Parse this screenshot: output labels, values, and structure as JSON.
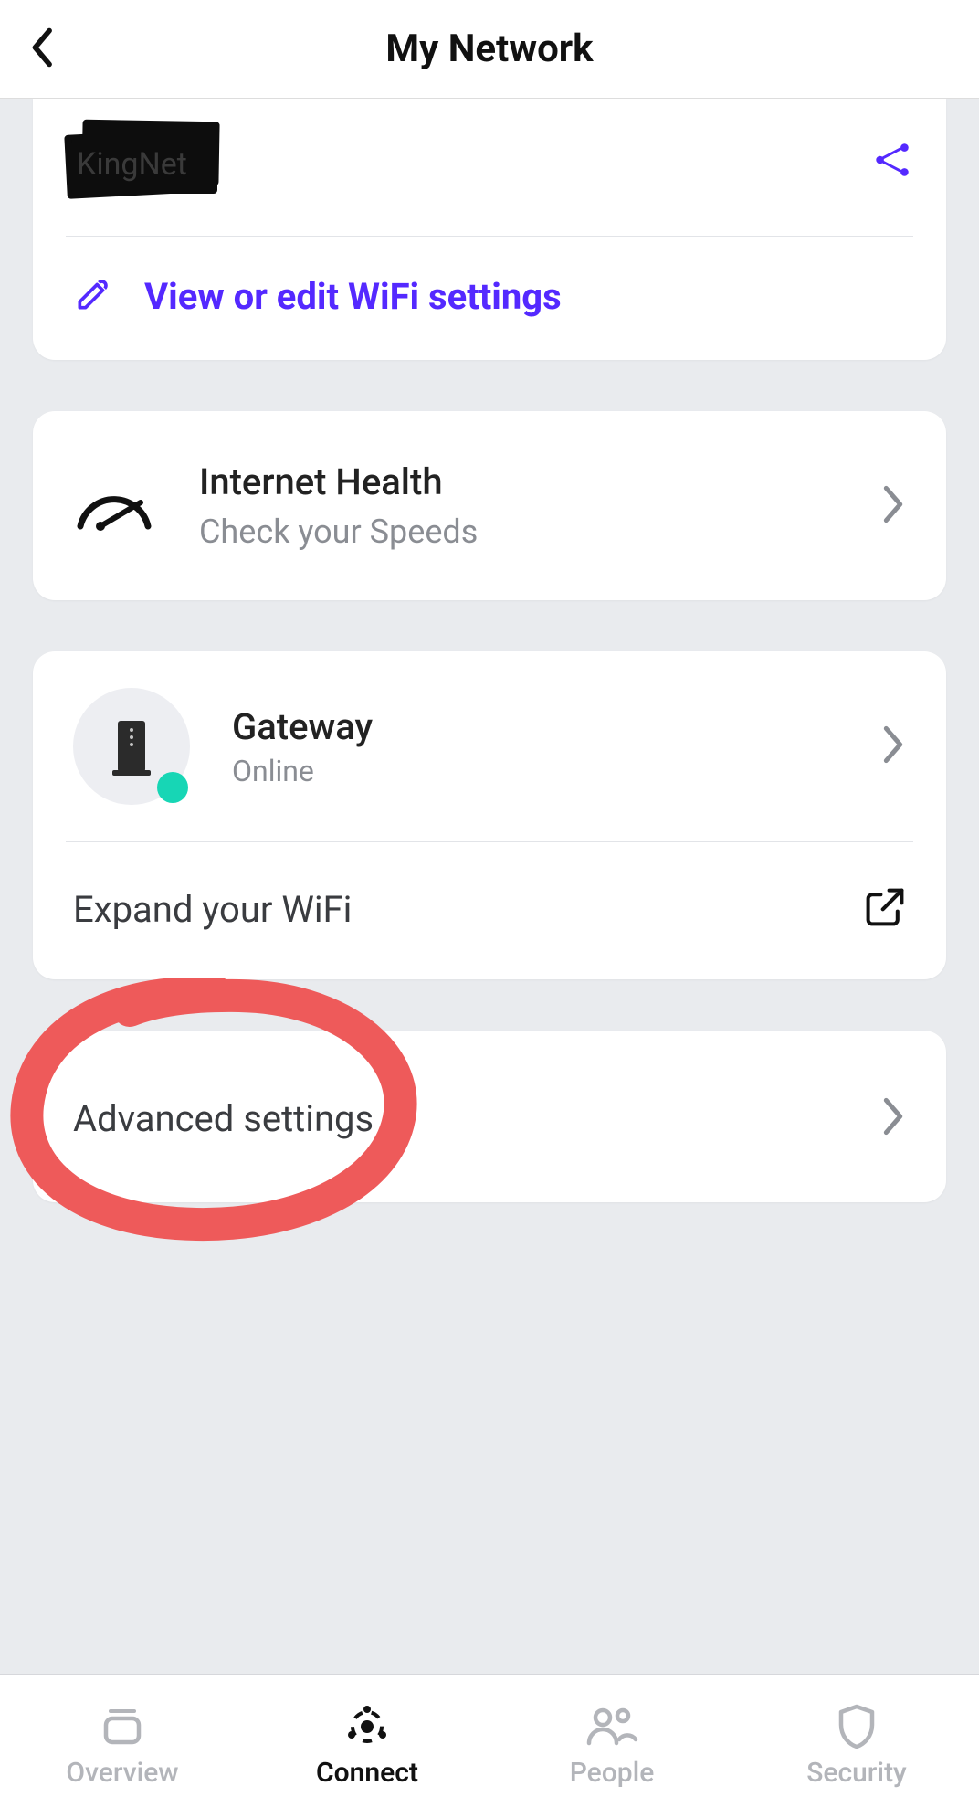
{
  "header": {
    "title": "My Network"
  },
  "wifi": {
    "network_name": "KingNet",
    "settings_label": "View or edit WiFi settings"
  },
  "internet_health": {
    "title": "Internet Health",
    "subtitle": "Check your Speeds"
  },
  "gateway": {
    "title": "Gateway",
    "status": "Online",
    "expand_label": "Expand your WiFi"
  },
  "advanced": {
    "label": "Advanced settings"
  },
  "tabs": {
    "overview": "Overview",
    "connect": "Connect",
    "people": "People",
    "security": "Security"
  },
  "colors": {
    "accent": "#5429ff",
    "online": "#17d6b5",
    "annotation": "#ee5a5a"
  }
}
